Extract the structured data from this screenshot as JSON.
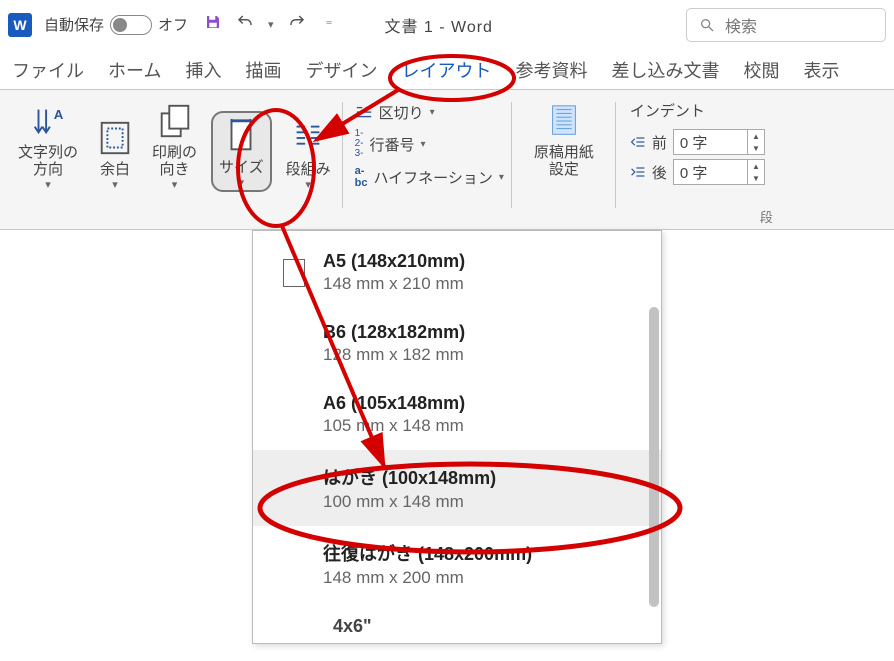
{
  "titlebar": {
    "autosave_label": "自動保存",
    "autosave_state": "オフ",
    "doc_title": "文書 1  -  Word",
    "search_placeholder": "検索"
  },
  "tabs": {
    "items": [
      "ファイル",
      "ホーム",
      "挿入",
      "描画",
      "デザイン",
      "レイアウト",
      "参考資料",
      "差し込み文書",
      "校閲",
      "表示"
    ],
    "active": "レイアウト"
  },
  "ribbon": {
    "text_direction": "文字列の\n方向",
    "margins": "余白",
    "orientation": "印刷の\n向き",
    "size": "サイズ",
    "columns": "段組み",
    "breaks": "区切り",
    "line_numbers": "行番号",
    "hyphenation": "ハイフネーション",
    "manuscript": "原稿用紙\n設定",
    "indent_title": "インデント",
    "before_label": "前",
    "after_label": "後",
    "before_val": "0 字",
    "after_val": "0 字",
    "group_label": "段"
  },
  "size_dropdown": {
    "items": [
      {
        "name": "A5 (148x210mm)",
        "dim": "148 mm x 210 mm",
        "has_icon": true
      },
      {
        "name": "B6 (128x182mm)",
        "dim": "128 mm x 182 mm",
        "has_icon": false
      },
      {
        "name": "A6 (105x148mm)",
        "dim": "105 mm x 148 mm",
        "has_icon": false
      },
      {
        "name": "はがき (100x148mm)",
        "dim": "100 mm x 148 mm",
        "has_icon": false,
        "hover": true
      },
      {
        "name": "往復はがき (148x200mm)",
        "dim": "148 mm x 200 mm",
        "has_icon": false
      }
    ],
    "last": "4x6\""
  },
  "annotation_color": "#d40000"
}
